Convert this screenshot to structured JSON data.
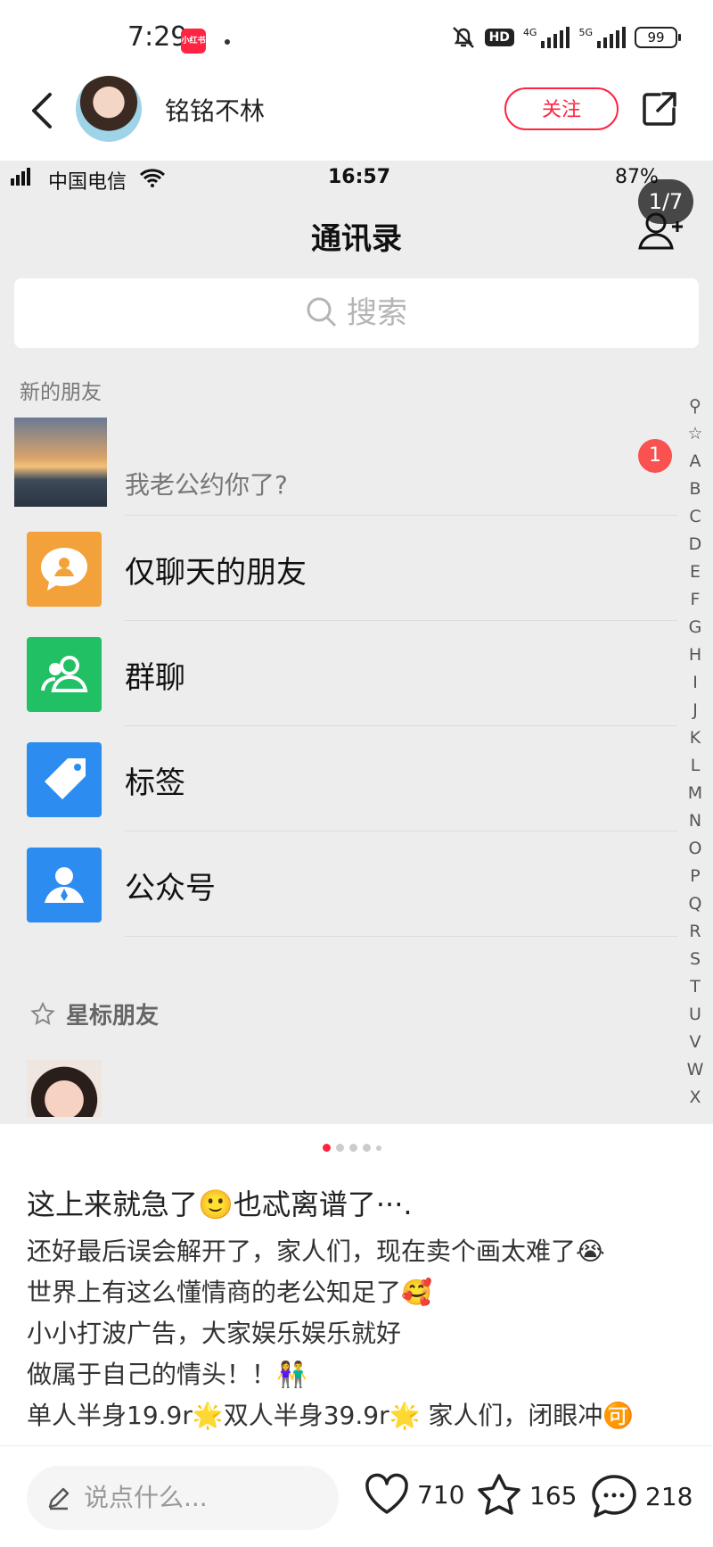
{
  "status_bar": {
    "time": "7:29",
    "app_badge": "小红书",
    "battery": "99",
    "net1": "4G",
    "net2": "5G",
    "hd": "HD"
  },
  "header": {
    "author": "铭铭不林",
    "follow_label": "关注"
  },
  "screenshot": {
    "status": {
      "carrier": "中国电信",
      "time": "16:57",
      "battery": "87%"
    },
    "pager": "1/7",
    "title": "通讯录",
    "search_placeholder": "搜索",
    "new_friends_label": "新的朋友",
    "new_friend_message": "我老公约你了?",
    "new_friend_badge": "1",
    "menu": [
      {
        "label": "仅聊天的朋友",
        "icon": "chat-only-friends-icon",
        "color": "#f3a13a"
      },
      {
        "label": "群聊",
        "icon": "group-chat-icon",
        "color": "#22c064"
      },
      {
        "label": "标签",
        "icon": "tag-icon",
        "color": "#2c8cf0"
      },
      {
        "label": "公众号",
        "icon": "official-account-icon",
        "color": "#2c8cf0"
      }
    ],
    "starred_label": "星标朋友",
    "alphabet": [
      "A",
      "B",
      "C",
      "D",
      "E",
      "F",
      "G",
      "H",
      "I",
      "J",
      "K",
      "L",
      "M",
      "N",
      "O",
      "P",
      "Q",
      "R",
      "S",
      "T",
      "U",
      "V",
      "W",
      "X"
    ]
  },
  "post": {
    "title": "这上来就急了🙂也忒离谱了···.",
    "lines": [
      "还好最后误会解开了，家人们，现在卖个画太难了😭",
      "世界上有这么懂情商的老公知足了🥰",
      "小小打波广告，大家娱乐娱乐就好",
      "做属于自己的情头！！👫",
      "单人半身19.9r🌟双人半身39.9r🌟  家人们，闭眼冲🉑"
    ]
  },
  "bottom_bar": {
    "input_placeholder": "说点什么...",
    "likes": "710",
    "stars": "165",
    "comments": "218"
  },
  "colors": {
    "accent": "#ff2442",
    "wechat_badge": "#fa5151"
  }
}
